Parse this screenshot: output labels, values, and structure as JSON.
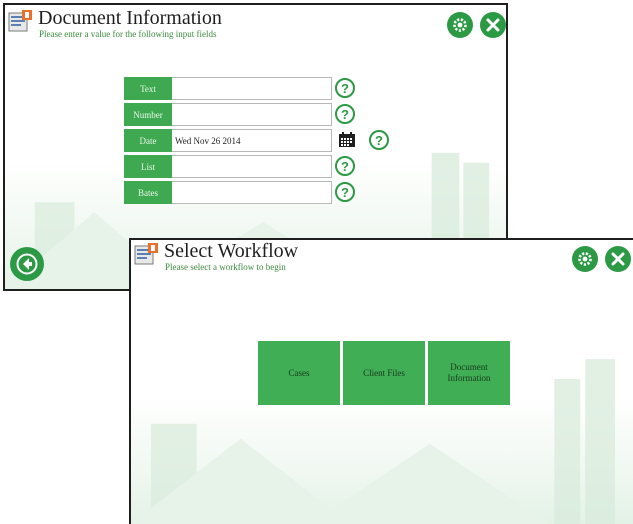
{
  "colors": {
    "accent": "#2c9a44",
    "field_label_bg": "#3ea950",
    "tile_bg": "#3fae54",
    "subtitle": "#3a8a3a"
  },
  "document_info": {
    "title": "Document Information",
    "subtitle": "Please enter a value for the following input fields",
    "fields": [
      {
        "label": "Text",
        "value": ""
      },
      {
        "label": "Number",
        "value": ""
      },
      {
        "label": "Date",
        "value": "Wed Nov 26 2014"
      },
      {
        "label": "List",
        "value": ""
      },
      {
        "label": "Bates",
        "value": ""
      }
    ],
    "help_glyph": "?",
    "icons": {
      "settings": "gear-icon",
      "close": "close-icon",
      "back": "arrow-left-icon",
      "calendar": "calendar-icon"
    }
  },
  "select_workflow": {
    "title": "Select Workflow",
    "subtitle": "Please select a workflow to begin",
    "tiles": [
      {
        "label": "Cases"
      },
      {
        "label": "Client Files"
      },
      {
        "label": "Document Information"
      }
    ],
    "icons": {
      "settings": "gear-icon",
      "close": "close-icon"
    }
  }
}
